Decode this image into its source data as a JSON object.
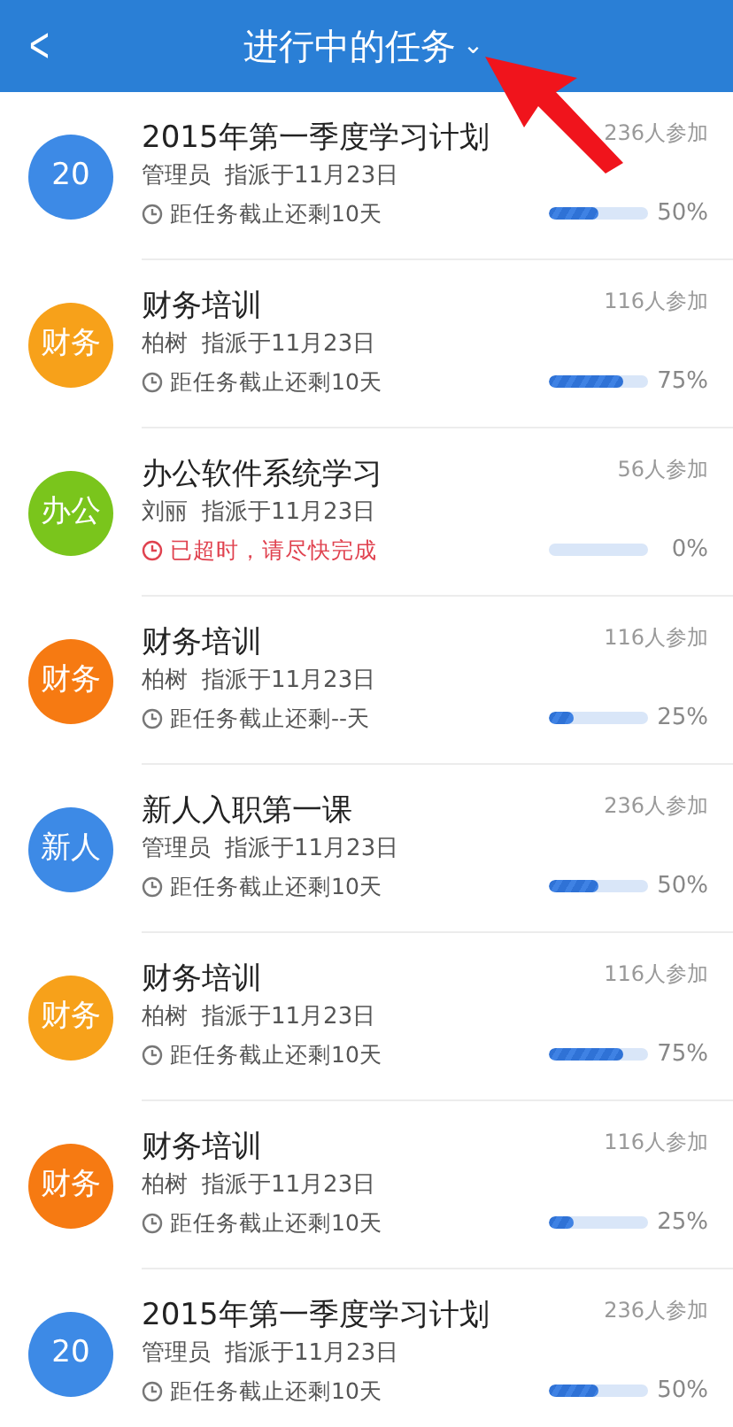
{
  "header": {
    "back": "<",
    "title": "进行中的任务",
    "dropdown": "⌄"
  },
  "tasks": [
    {
      "badge": "20",
      "color": "#3d8ae6",
      "title": "2015年第一季度学习计划",
      "assigner": "管理员",
      "assigned": "指派于11月23日",
      "participants": "236人参加",
      "status": "距任务截止还剩10天",
      "overdue": false,
      "level": 0.5,
      "percent": "50%"
    },
    {
      "badge": "财务",
      "color": "#f7a11a",
      "title": "财务培训",
      "assigner": "柏树",
      "assigned": "指派于11月23日",
      "participants": "116人参加",
      "status": "距任务截止还剩10天",
      "overdue": false,
      "level": 0.75,
      "percent": "75%"
    },
    {
      "badge": "办公",
      "color": "#7ac51c",
      "title": "办公软件系统学习",
      "assigner": "刘丽",
      "assigned": "指派于11月23日",
      "participants": "56人参加",
      "status": "已超时，请尽快完成",
      "overdue": true,
      "percent": "0%"
    },
    {
      "badge": "财务",
      "color": "#f67a12",
      "title": "财务培训",
      "assigner": "柏树",
      "assigned": "指派于11月23日",
      "participants": "116人参加",
      "status": "距任务截止还剩--天",
      "overdue": false,
      "level": 0.25,
      "percent": "25%"
    },
    {
      "badge": "新人",
      "color": "#3d8ae6",
      "title": "新人入职第一课",
      "assigner": "管理员",
      "assigned": "指派于11月23日",
      "participants": "236人参加",
      "status": "距任务截止还剩10天",
      "overdue": false,
      "level": 0.5,
      "percent": "50%"
    },
    {
      "badge": "财务",
      "color": "#f7a11a",
      "title": "财务培训",
      "assigner": "柏树",
      "assigned": "指派于11月23日",
      "participants": "116人参加",
      "status": "距任务截止还剩10天",
      "overdue": false,
      "level": 0.75,
      "percent": "75%"
    },
    {
      "badge": "财务",
      "color": "#f67a12",
      "title": "财务培训",
      "assigner": "柏树",
      "assigned": "指派于11月23日",
      "participants": "116人参加",
      "status": "距任务截止还剩10天",
      "overdue": false,
      "level": 0.25,
      "percent": "25%"
    },
    {
      "badge": "20",
      "color": "#3d8ae6",
      "title": "2015年第一季度学习计划",
      "assigner": "管理员",
      "assigned": "指派于11月23日",
      "participants": "236人参加",
      "status": "距任务截止还剩10天",
      "overdue": false,
      "level": 0.5,
      "percent": "50%"
    }
  ]
}
